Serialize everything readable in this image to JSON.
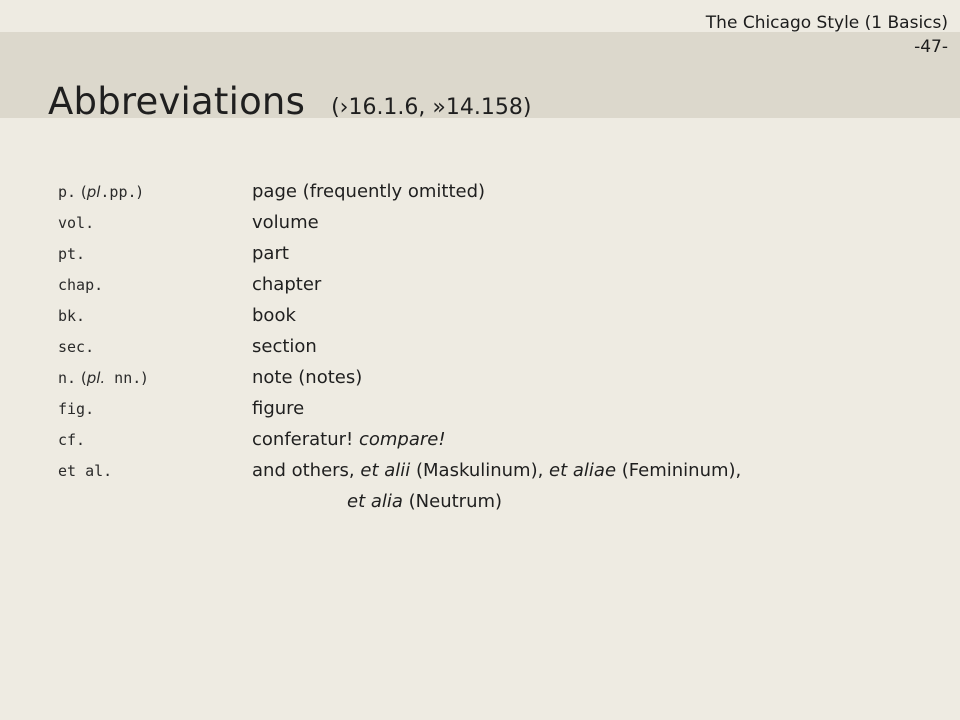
{
  "header": {
    "course": "The Chicago Style (1 Basics)",
    "page": "-47-"
  },
  "title": {
    "main": "Abbreviations",
    "refs": "(›16.1.6, »14.158)"
  },
  "rows": [
    {
      "abbr_a": "p.",
      "open": " (",
      "pl": "pl",
      "abbr_b": ".pp.",
      "close": ")",
      "meaning": "page (frequently omitted)"
    },
    {
      "abbr": "vol.",
      "meaning": "volume"
    },
    {
      "abbr": "pt.",
      "meaning": "part"
    },
    {
      "abbr": "chap.",
      "meaning": "chapter"
    },
    {
      "abbr": "bk.",
      "meaning": "book"
    },
    {
      "abbr": "sec.",
      "meaning": "section"
    },
    {
      "abbr_a": "n.",
      "open": " (",
      "pl": "pl.",
      "abbr_b": " nn.",
      "close": ")",
      "meaning": "note (notes)"
    },
    {
      "abbr": "fig.",
      "meaning": "figure"
    },
    {
      "abbr": "cf.",
      "meaning_plain": "conferatur! ",
      "meaning_italic": "compare!"
    },
    {
      "abbr": "et al.",
      "m1": "and others, ",
      "m2": "et alii",
      "m3": " (Maskulinum), ",
      "m4": "et aliae",
      "m5": " (Femininum),",
      "c1": "et alia",
      "c2": " (Neutrum)"
    }
  ]
}
